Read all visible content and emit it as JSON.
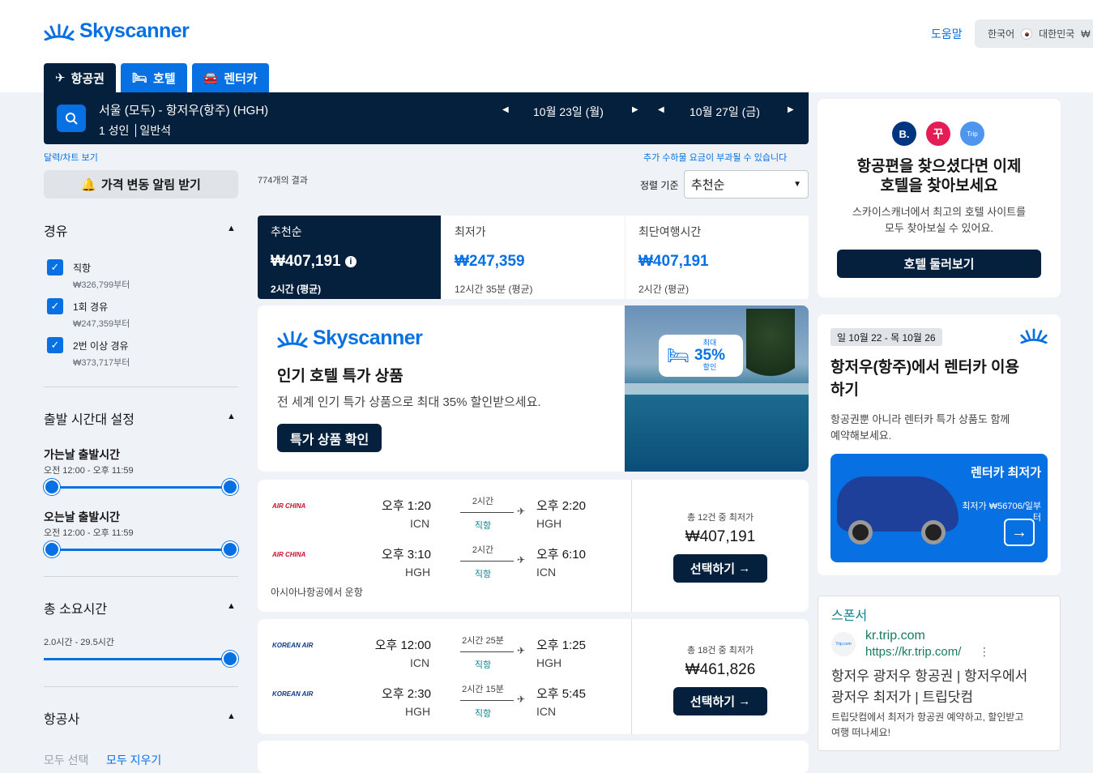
{
  "header": {
    "brand": "Skyscanner",
    "help": "도움말",
    "locale": {
      "language": "한국어",
      "country": "대한민국",
      "currency": "₩"
    }
  },
  "tabs": [
    {
      "label": "항공권",
      "icon": "plane-icon"
    },
    {
      "label": "호텔",
      "icon": "bed-icon"
    },
    {
      "label": "렌터카",
      "icon": "car-icon"
    }
  ],
  "search": {
    "route": "서울 (모두) - 항저우(항주) (HGH)",
    "travellers": "1 성인",
    "cabin": "일반석",
    "depart_date": "10월 23일 (월)",
    "return_date": "10월 27일 (금)"
  },
  "links": {
    "calendar": "달력/차트 보기",
    "fees": "추가 수하물 요금이 부과될 수 있습니다"
  },
  "sidebar": {
    "alert_button": "가격 변동 알림 받기",
    "stops": {
      "title": "경유",
      "options": [
        {
          "label": "직항",
          "price": "₩326,799부터",
          "checked": true
        },
        {
          "label": "1회 경유",
          "price": "₩247,359부터",
          "checked": true
        },
        {
          "label": "2번 이상 경유",
          "price": "₩373,717부터",
          "checked": true
        }
      ]
    },
    "departure_times": {
      "title": "출발 시간대 설정",
      "outbound_label": "가는날 출발시간",
      "outbound_range": "오전 12:00 - 오후 11:59",
      "return_label": "오는날 출발시간",
      "return_range": "오전 12:00 - 오후 11:59"
    },
    "duration": {
      "title": "총 소요시간",
      "range": "2.0시간 - 29.5시간"
    },
    "airlines": {
      "title": "항공사",
      "select_all": "모두 선택",
      "clear_all": "모두 지우기"
    }
  },
  "results": {
    "count": "774개의 결과",
    "sort_label": "정렬 기준",
    "sort_value": "추천순",
    "sort_tabs": [
      {
        "name": "추천순",
        "price": "₩407,191",
        "sub": "2시간 (평균)"
      },
      {
        "name": "최저가",
        "price": "₩247,359",
        "sub": "12시간 35분 (평균)"
      },
      {
        "name": "최단여행시간",
        "price": "₩407,191",
        "sub": "2시간 (평균)"
      }
    ]
  },
  "promo": {
    "brand": "Skyscanner",
    "title": "인기 호텔 특가 상품",
    "desc": "전 세계 인기 특가 상품으로 최대 35% 할인받으세요.",
    "button": "특가 상품 확인",
    "badge_top": "최대",
    "badge_pct": "35%",
    "badge_bottom": "할인"
  },
  "flights": [
    {
      "airline": "AIR CHINA",
      "operated_by": "아시아나항공에서 운항",
      "legs": [
        {
          "dep": "오후 1:20",
          "dep_ap": "ICN",
          "arr": "오후 2:20",
          "arr_ap": "HGH",
          "dur": "2시간",
          "stops": "직항"
        },
        {
          "dep": "오후 3:10",
          "dep_ap": "HGH",
          "arr": "오후 6:10",
          "arr_ap": "ICN",
          "dur": "2시간",
          "stops": "직항"
        }
      ],
      "deals": "총 12건 중 최저가",
      "price": "₩407,191",
      "button": "선택하기"
    },
    {
      "airline": "KOREAN AIR",
      "operated_by": "",
      "legs": [
        {
          "dep": "오후 12:00",
          "dep_ap": "ICN",
          "arr": "오후 1:25",
          "arr_ap": "HGH",
          "dur": "2시간 25분",
          "stops": "직항"
        },
        {
          "dep": "오후 2:30",
          "dep_ap": "HGH",
          "arr": "오후 5:45",
          "arr_ap": "ICN",
          "dur": "2시간 15분",
          "stops": "직항"
        }
      ],
      "deals": "총 18건 중 최저가",
      "price": "₩461,826",
      "button": "선택하기"
    }
  ],
  "right": {
    "hotel_card": {
      "title_line1": "항공편을 찾으셨다면 이제",
      "title_line2": "호텔을 찾아보세요",
      "desc_line1": "스카이스캐너에서 최고의 호텔 사이트를",
      "desc_line2": "모두 찾아보실 수 있어요.",
      "button": "호텔 둘러보기",
      "partner_b": "B.",
      "partner_trip": "Trip"
    },
    "car_card": {
      "dates": "일 10월 22 - 목 10월 26",
      "title_line1": "항저우(항주)에서 렌터카 이용",
      "title_line2": "하기",
      "desc_line1": "항공권뿐 아니라 렌터카 특가 상품도 함께",
      "desc_line2": "예약해보세요.",
      "banner_title": "렌터카 최저가",
      "banner_sub": "최저가 ₩56706/일부터"
    },
    "sponsor": {
      "label": "스폰서",
      "domain": "kr.trip.com",
      "url": "https://kr.trip.com/",
      "headline_line1": "항저우 광저우 항공권 | 항저우에서",
      "headline_line2": "광저우 최저가 | 트립닷컴",
      "desc_line1": "트립닷컴에서 최저가 항공권 예약하고, 할인받고",
      "desc_line2": "여행 떠나세요!",
      "logo_text": "Trip.com"
    }
  },
  "colors": {
    "primary": "#0770e3",
    "dark": "#05203c",
    "teal": "#0c838a"
  }
}
